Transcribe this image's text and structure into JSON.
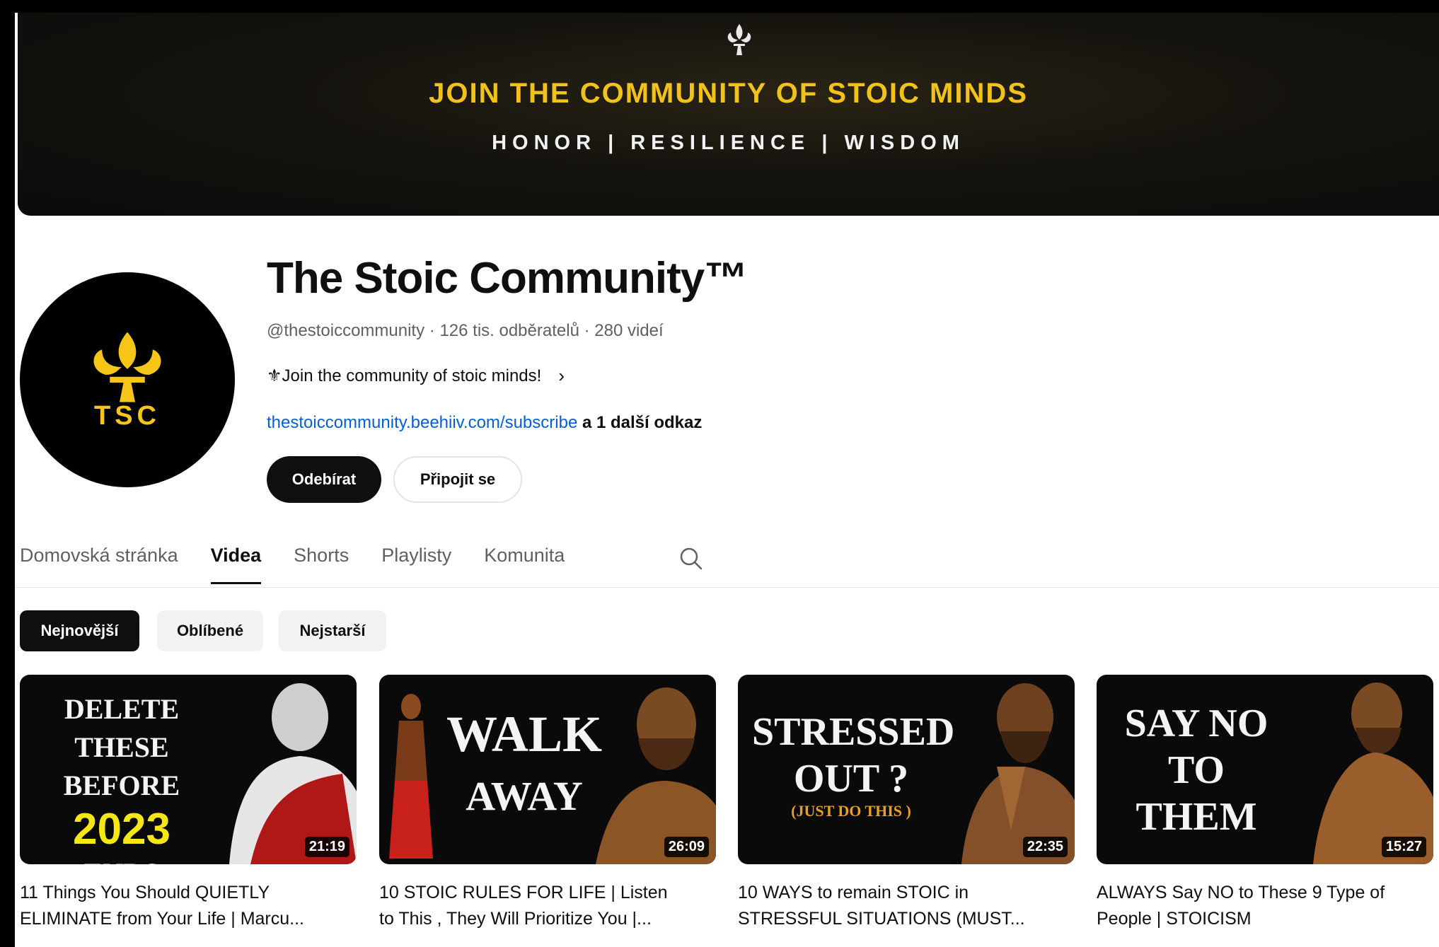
{
  "banner": {
    "title": "JOIN THE COMMUNITY OF STOIC MINDS",
    "subtitle": "HONOR | RESILIENCE | WISDOM"
  },
  "channel": {
    "avatar_text": "TSC",
    "name": "The Stoic Community™",
    "handle": "@thestoiccommunity",
    "subscribers": "126 tis. odběratelů",
    "video_count": "280 videí",
    "meta_separator": " · ",
    "tagline": "⚜Join the community of stoic minds!",
    "link_url": "thestoiccommunity.beehiiv.com/subscribe",
    "link_more": " a 1 další odkaz",
    "subscribe_label": "Odebírat",
    "join_label": "Připojit se"
  },
  "tabs": [
    {
      "label": "Domovská stránka"
    },
    {
      "label": "Videa",
      "active": true
    },
    {
      "label": "Shorts"
    },
    {
      "label": "Playlisty"
    },
    {
      "label": "Komunita"
    }
  ],
  "chips": [
    {
      "label": "Nejnovější",
      "active": true
    },
    {
      "label": "Oblíbené"
    },
    {
      "label": "Nejstarší"
    }
  ],
  "videos": [
    {
      "thumb_lines": [
        "DELETE THESE",
        "BEFORE",
        "2023",
        "ENDS"
      ],
      "duration": "21:19",
      "title_line1": "11 Things You Should QUIETLY",
      "title_line2": "ELIMINATE from Your Life | Marcu..."
    },
    {
      "thumb_lines": [
        "WALK",
        "AWAY"
      ],
      "duration": "26:09",
      "title_line1": "10 STOIC RULES FOR LIFE | Listen",
      "title_line2": "to This , They Will Prioritize You |..."
    },
    {
      "thumb_lines": [
        "STRESSED",
        "OUT ?",
        "(JUST DO THIS )"
      ],
      "duration": "22:35",
      "title_line1": "10 WAYS to remain STOIC in",
      "title_line2": "STRESSFUL SITUATIONS (MUST..."
    },
    {
      "thumb_lines": [
        "SAY NO",
        "TO",
        "THEM"
      ],
      "duration": "15:27",
      "title_line1": "ALWAYS Say NO to These 9 Type of",
      "title_line2": "People | STOICISM"
    }
  ],
  "colors": {
    "banner_gold": "#f1c21b",
    "link_blue": "#065fd4",
    "thumb_highlight_yellow": "#f5e616",
    "thumb_subtext_orange": "#e8a020"
  }
}
